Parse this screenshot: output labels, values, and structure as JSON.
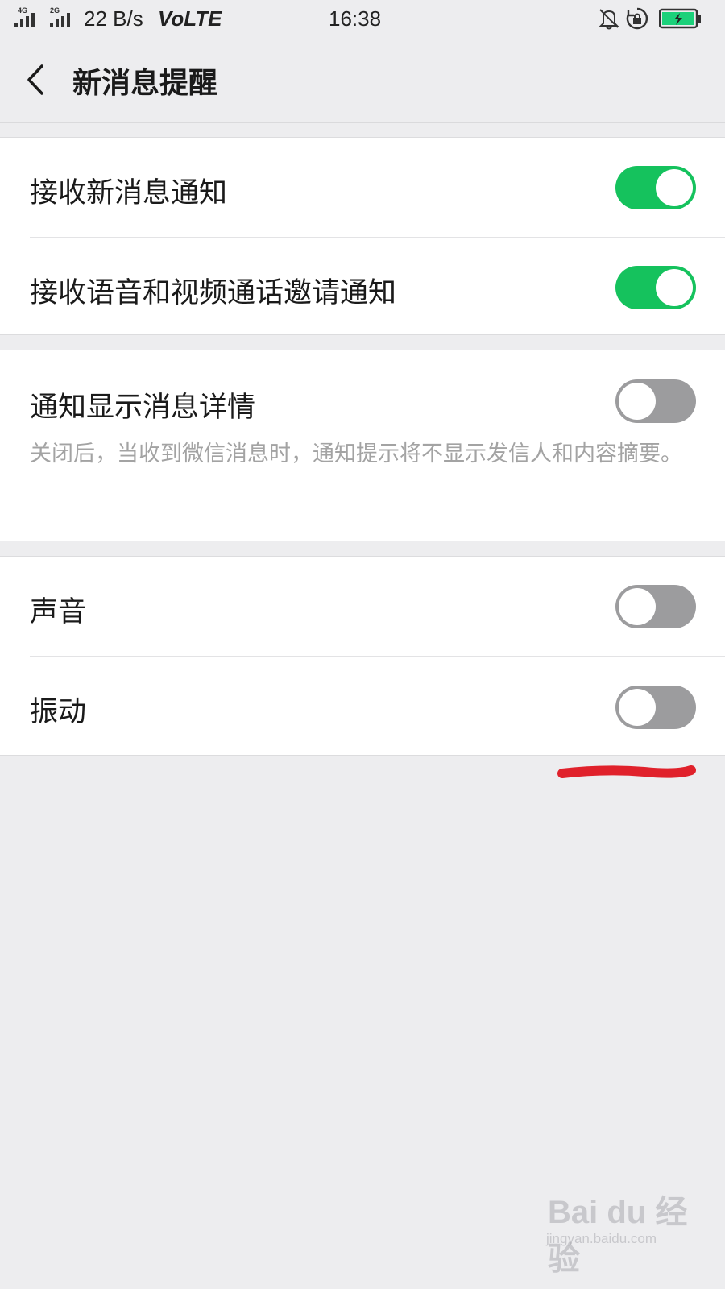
{
  "status_bar": {
    "net_label_1": "4G",
    "net_label_2": "2G",
    "speed": "22 B/s",
    "volte": "VoLTE",
    "time": "16:38",
    "icons": [
      "signal-icon",
      "mute-bell-icon",
      "rotation-lock-icon",
      "battery-charging-icon"
    ]
  },
  "nav": {
    "back_icon": "chevron-left-icon",
    "title": "新消息提醒"
  },
  "groups": {
    "notify": {
      "items": [
        {
          "label": "接收新消息通知",
          "enabled": true
        },
        {
          "label": "接收语音和视频通话邀请通知",
          "enabled": true
        }
      ]
    },
    "details": {
      "label": "通知显示消息详情",
      "enabled": false,
      "description": "关闭后，当收到微信消息时，通知提示将不显示发信人和内容摘要。"
    },
    "alerts": {
      "items": [
        {
          "label": "声音",
          "enabled": false
        },
        {
          "label": "振动",
          "enabled": false
        }
      ]
    }
  },
  "colors": {
    "toggle_on": "#15c25d",
    "toggle_off": "#9c9c9e",
    "annotation": "#e0212b"
  },
  "watermark": {
    "main": "Bai du 经验",
    "sub": "jingyan.baidu.com"
  }
}
